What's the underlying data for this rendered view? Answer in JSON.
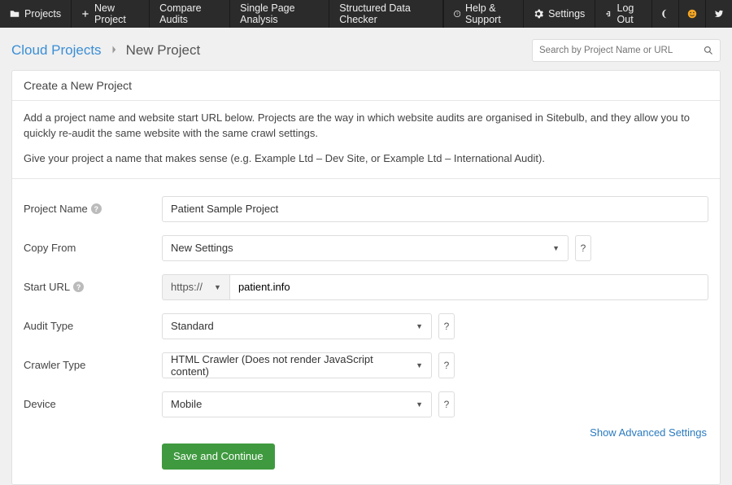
{
  "topbar": {
    "left": [
      {
        "icon": "folder",
        "label": "Projects"
      },
      {
        "icon": "plus",
        "label": "New Project"
      },
      {
        "icon": null,
        "label": "Compare Audits"
      },
      {
        "icon": null,
        "label": "Single Page Analysis"
      },
      {
        "icon": null,
        "label": "Structured Data Checker"
      }
    ],
    "right": {
      "help": "Help & Support",
      "settings": "Settings",
      "logout": "Log Out"
    }
  },
  "breadcrumb": {
    "root": "Cloud Projects",
    "current": "New Project"
  },
  "search": {
    "placeholder": "Search by Project Name or URL"
  },
  "panel": {
    "title": "Create a New Project",
    "desc1": "Add a project name and website start URL below. Projects are the way in which website audits are organised in Sitebulb, and they allow you to quickly re-audit the same website with the same crawl settings.",
    "desc2": "Give your project a name that makes sense (e.g. Example Ltd – Dev Site, or Example Ltd – International Audit)."
  },
  "form": {
    "project_name": {
      "label": "Project Name",
      "value": "Patient Sample Project"
    },
    "copy_from": {
      "label": "Copy From",
      "value": "New Settings"
    },
    "start_url": {
      "label": "Start URL",
      "protocol": "https://",
      "value": "patient.info"
    },
    "audit_type": {
      "label": "Audit Type",
      "value": "Standard"
    },
    "crawler_type": {
      "label": "Crawler Type",
      "value": "HTML Crawler (Does not render JavaScript content)"
    },
    "device": {
      "label": "Device",
      "value": "Mobile"
    },
    "advanced_link": "Show Advanced Settings",
    "submit": "Save and Continue"
  }
}
